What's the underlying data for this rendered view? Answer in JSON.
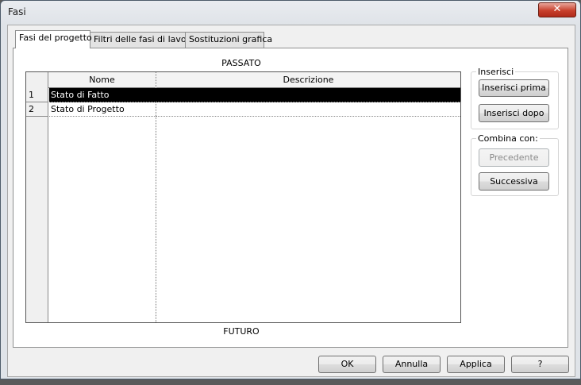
{
  "window": {
    "title": "Fasi",
    "close_glyph": "✕"
  },
  "tabs": [
    {
      "label": "Fasi del progetto",
      "active": true
    },
    {
      "label": "Filtri delle fasi di lavoro",
      "active": false
    },
    {
      "label": "Sostituzioni grafica",
      "active": false
    }
  ],
  "phases": {
    "top_label": "PASSATO",
    "bottom_label": "FUTURO",
    "columns": [
      "Nome",
      "Descrizione"
    ],
    "rows": [
      {
        "num": "1",
        "name": "Stato di Fatto",
        "description": "",
        "selected": true
      },
      {
        "num": "2",
        "name": "Stato di Progetto",
        "description": "",
        "selected": false
      }
    ]
  },
  "insert_group": {
    "label": "Inserisci",
    "before_label": "Inserisci prima",
    "after_label": "Inserisci dopo"
  },
  "combine_group": {
    "label": "Combina con:",
    "previous_label": "Precedente",
    "previous_enabled": false,
    "next_label": "Successiva"
  },
  "footer": {
    "ok_label": "OK",
    "cancel_label": "Annulla",
    "apply_label": "Applica",
    "help_label": "?"
  },
  "colors": {
    "selection": "#000000",
    "close_button": "#c8402c"
  }
}
